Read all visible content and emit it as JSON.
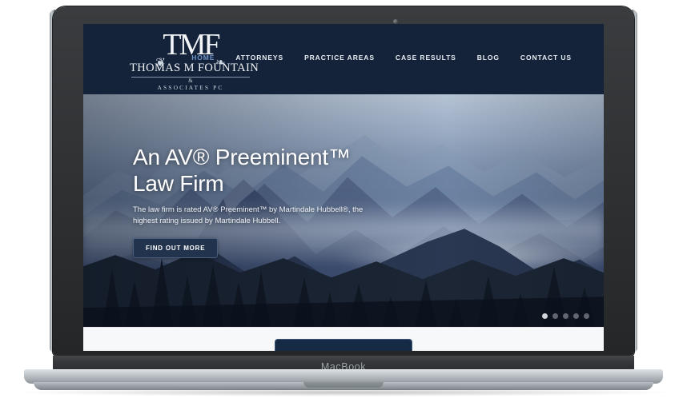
{
  "device": {
    "name": "MacBook",
    "label": "MacBook",
    "camera_icon": "camera-dot"
  },
  "site": {
    "header": {
      "background_color": "#142339",
      "logo": {
        "monogram": "TMF",
        "flourish_left": "❦",
        "flourish_right": "❧",
        "name": "THOMAS M FOUNTAIN",
        "ampersand": "&",
        "subtitle": "ASSOCIATES  PC"
      },
      "nav": {
        "active_color": "#6f93c9",
        "items": [
          {
            "label": "HOME",
            "active": true
          },
          {
            "label": "ATTORNEYS",
            "active": false
          },
          {
            "label": "PRACTICE AREAS",
            "active": false
          },
          {
            "label": "CASE RESULTS",
            "active": false
          },
          {
            "label": "BLOG",
            "active": false
          },
          {
            "label": "CONTACT US",
            "active": false
          }
        ]
      }
    },
    "hero": {
      "title_line_1": "An AV® Preeminent™",
      "title_line_2": "Law Firm",
      "subtitle": "The law firm is rated AV® Preeminent™ by Martindale Hubbell®,  the highest rating issued by Martindale Hubbell.",
      "cta_label": "FIND OUT MORE",
      "cta_background": "#22334e",
      "carousel": {
        "total": 5,
        "active_index": 0
      },
      "image_description": "misty blue layered mountain range with dark pine forest foreground"
    },
    "band": {
      "background_color": "#f7f8f9",
      "card_color": "#152a45"
    }
  }
}
